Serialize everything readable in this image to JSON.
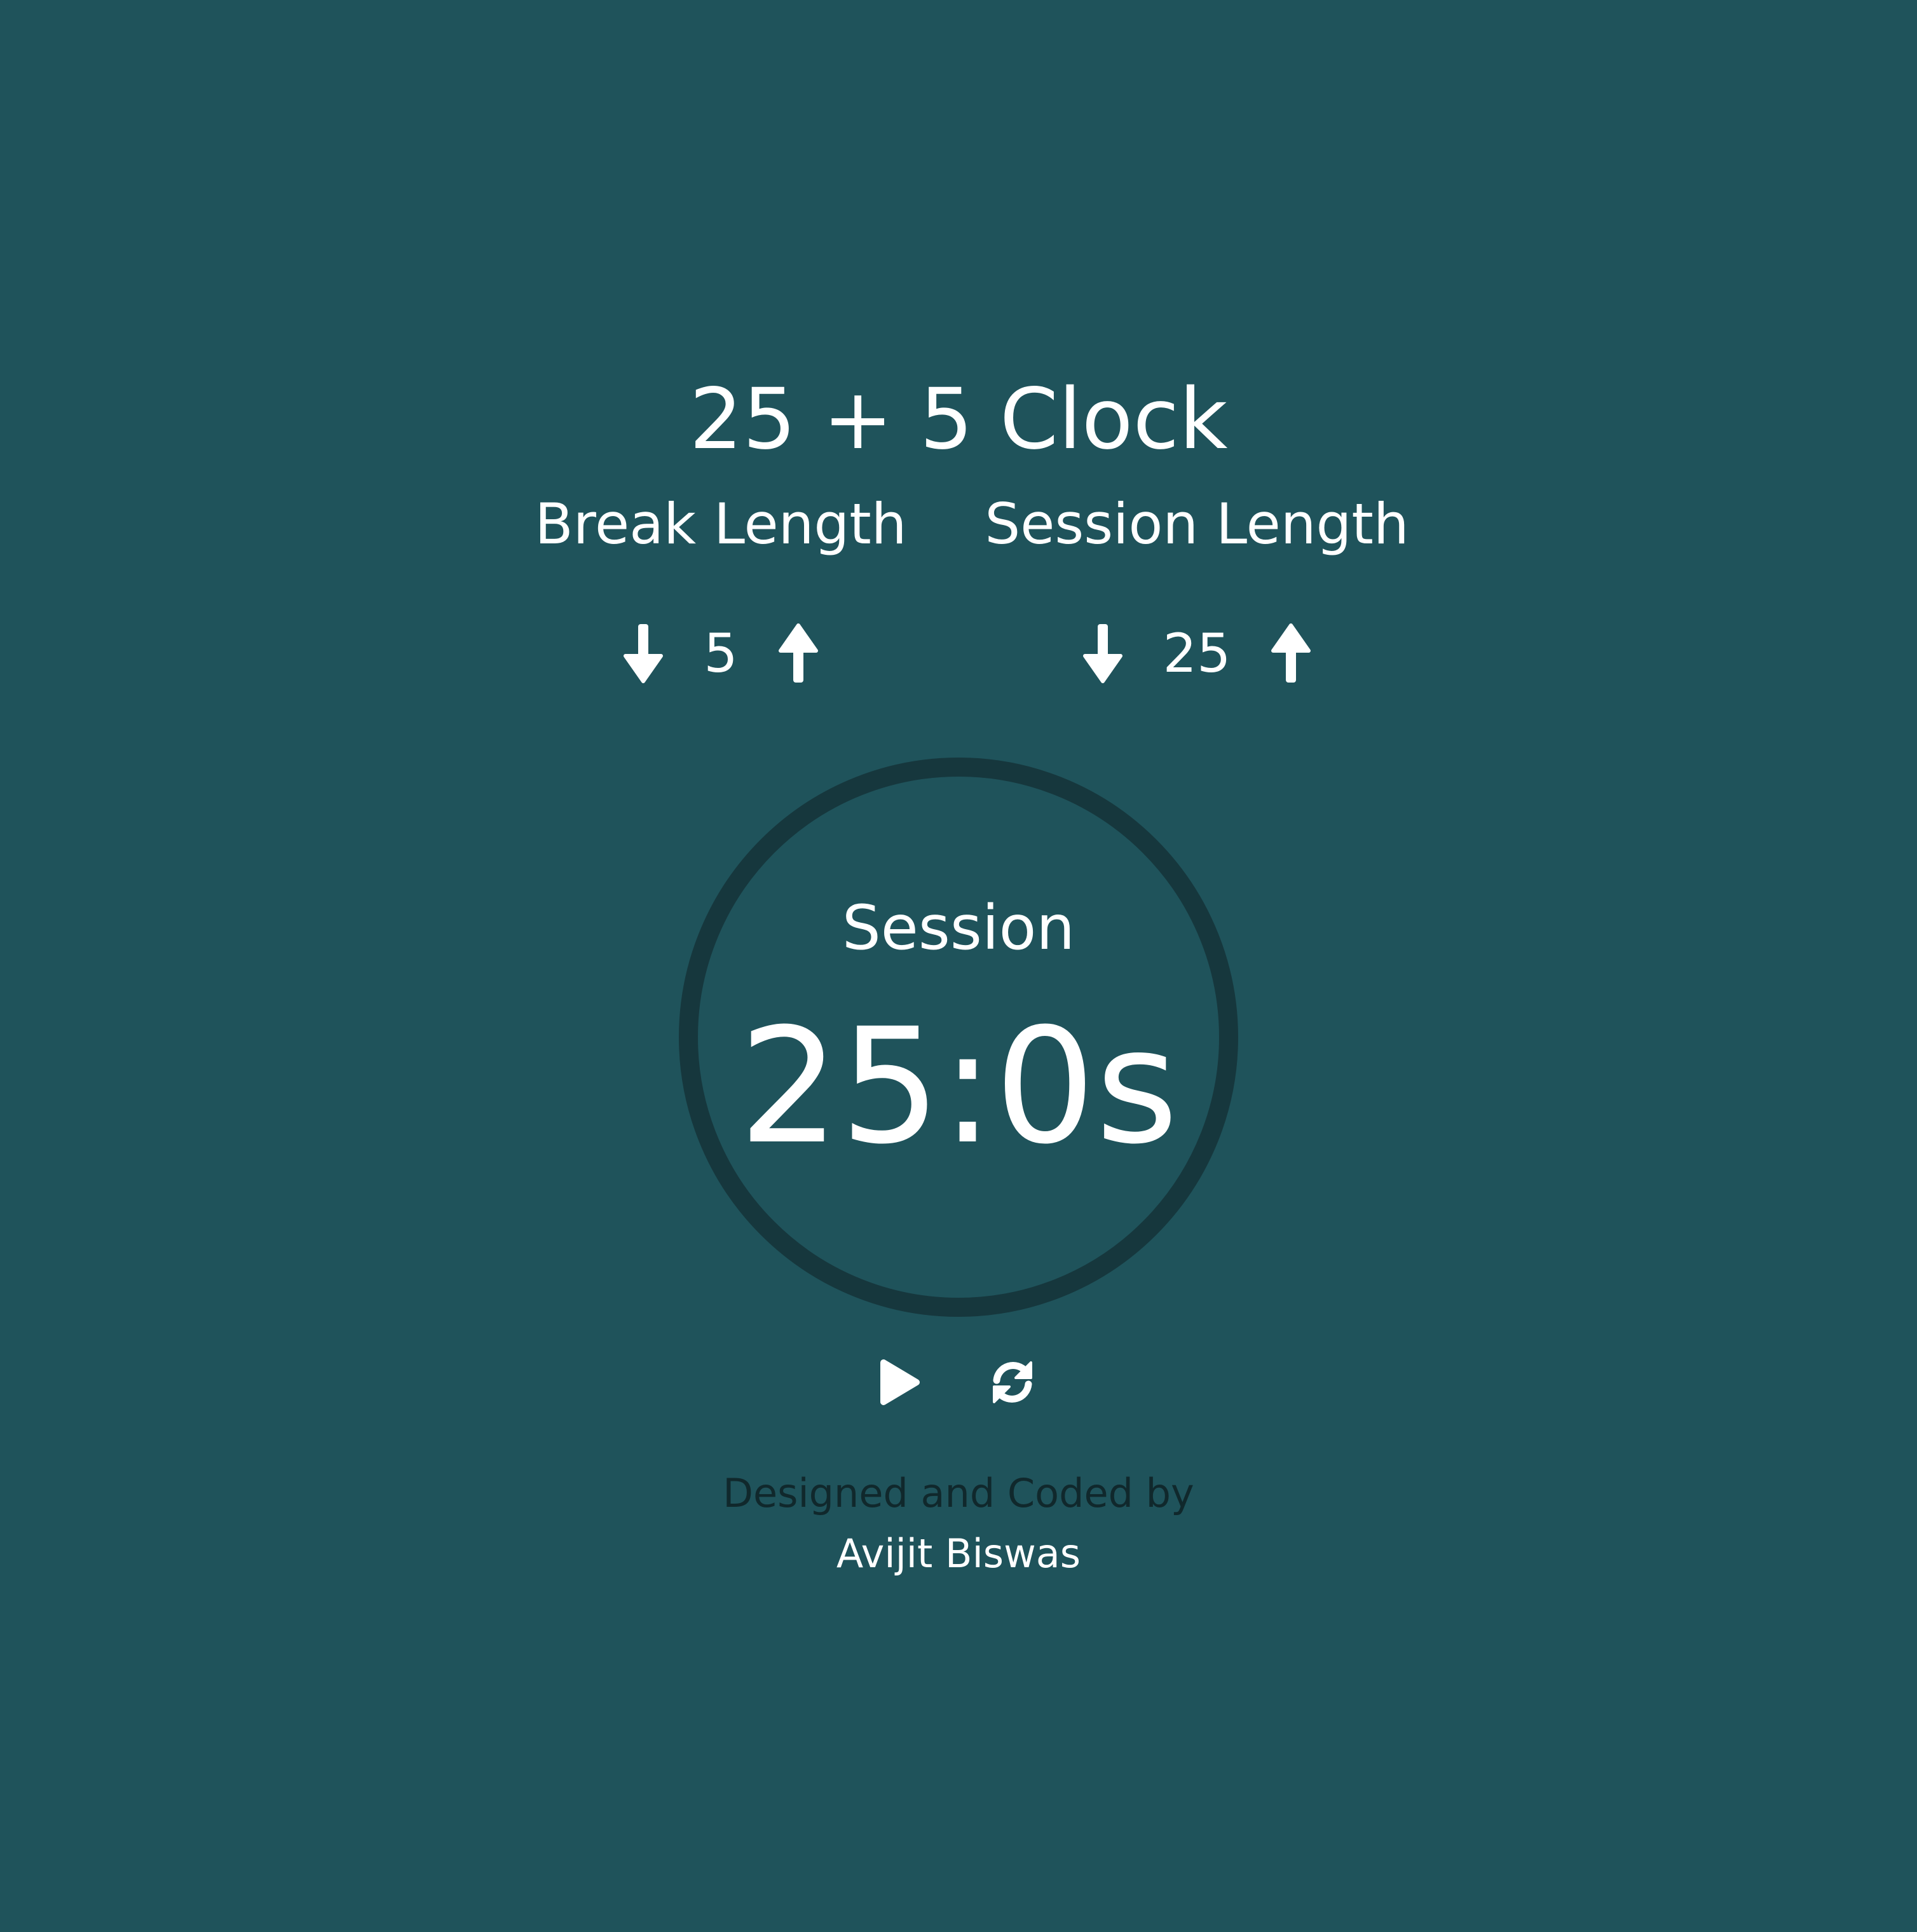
{
  "app": {
    "title": "25 + 5 Clock"
  },
  "break": {
    "label": "Break Length",
    "value": "5",
    "decrement_icon": "arrow-down-icon",
    "increment_icon": "arrow-up-icon"
  },
  "session": {
    "label": "Session Length",
    "value": "25",
    "decrement_icon": "arrow-down-icon",
    "increment_icon": "arrow-up-icon"
  },
  "timer": {
    "label": "Session",
    "time_left": "25:0s"
  },
  "controls": {
    "play_icon": "play-icon",
    "reset_icon": "refresh-icon"
  },
  "footer": {
    "credit": "Designed and Coded by",
    "author": "Avijit Biswas"
  },
  "colors": {
    "background": "#1f535b",
    "ring": "#16373d",
    "text": "#ffffff",
    "credit_text": "#10282c"
  }
}
